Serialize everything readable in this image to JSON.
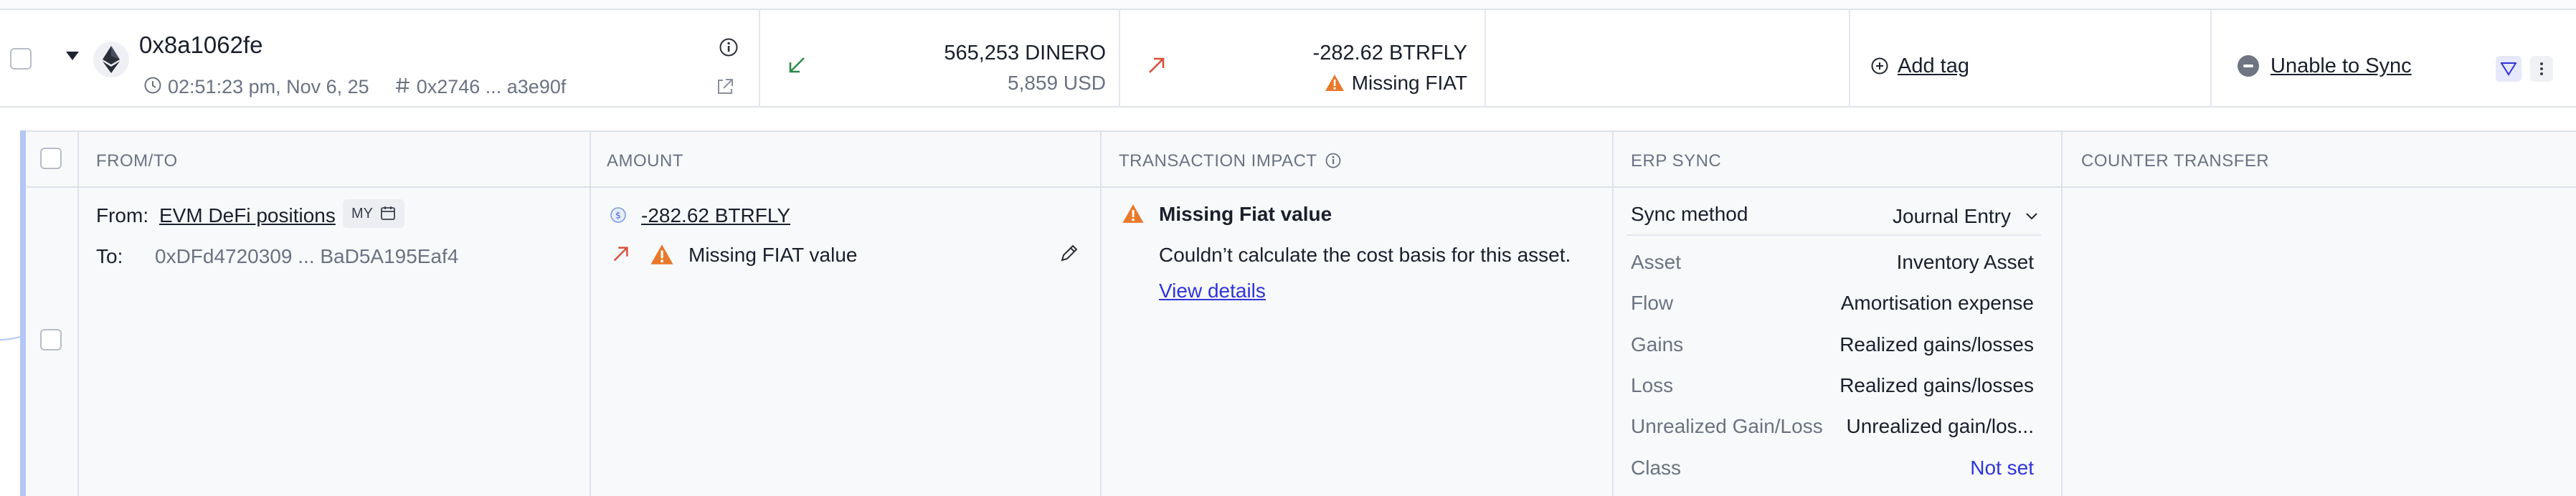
{
  "transaction": {
    "hash": "0x8a1062fe",
    "time": "02:51:23 pm, Nov 6, 25",
    "ref": "0x2746 ... a3e90f",
    "received_amount": "565,253 DINERO",
    "received_fiat": "5,859 USD",
    "sent_amount": "-282.62 BTRFLY",
    "sent_status": "Missing FIAT",
    "add_tag_label": "Add tag",
    "sync_status": "Unable to Sync"
  },
  "details": {
    "headers": {
      "from_to": "FROM/TO",
      "amount": "AMOUNT",
      "impact": "TRANSACTION IMPACT",
      "erp_sync": "ERP SYNC",
      "counter_transfer": "COUNTER TRANSFER"
    },
    "from_label": "From:",
    "from_value": "EVM DeFi positions",
    "from_badge": "MY",
    "to_label": "To:",
    "to_value": "0xDFd4720309 ... BaD5A195Eaf4",
    "amount_value": "-282.62 BTRFLY",
    "amount_status": "Missing FIAT value",
    "impact_title": "Missing Fiat value",
    "impact_desc": "Couldn’t calculate the cost basis for this asset.",
    "impact_link": "View details",
    "erp": {
      "sync_method_label": "Sync method",
      "sync_method_value": "Journal Entry",
      "rows": [
        {
          "label": "Asset",
          "value": "Inventory Asset"
        },
        {
          "label": "Flow",
          "value": "Amortisation expense"
        },
        {
          "label": "Gains",
          "value": "Realized gains/losses"
        },
        {
          "label": "Loss",
          "value": "Realized gains/losses"
        },
        {
          "label": "Unrealized Gain/Loss",
          "value": "Unrealized gain/los..."
        },
        {
          "label": "Class",
          "value": "Not set"
        }
      ]
    }
  },
  "colors": {
    "accent": "#2f35d8",
    "warning": "#e8792b",
    "received": "#2f8a4a",
    "sent": "#d84f3a",
    "panel_accent": "#b3c6f5"
  }
}
